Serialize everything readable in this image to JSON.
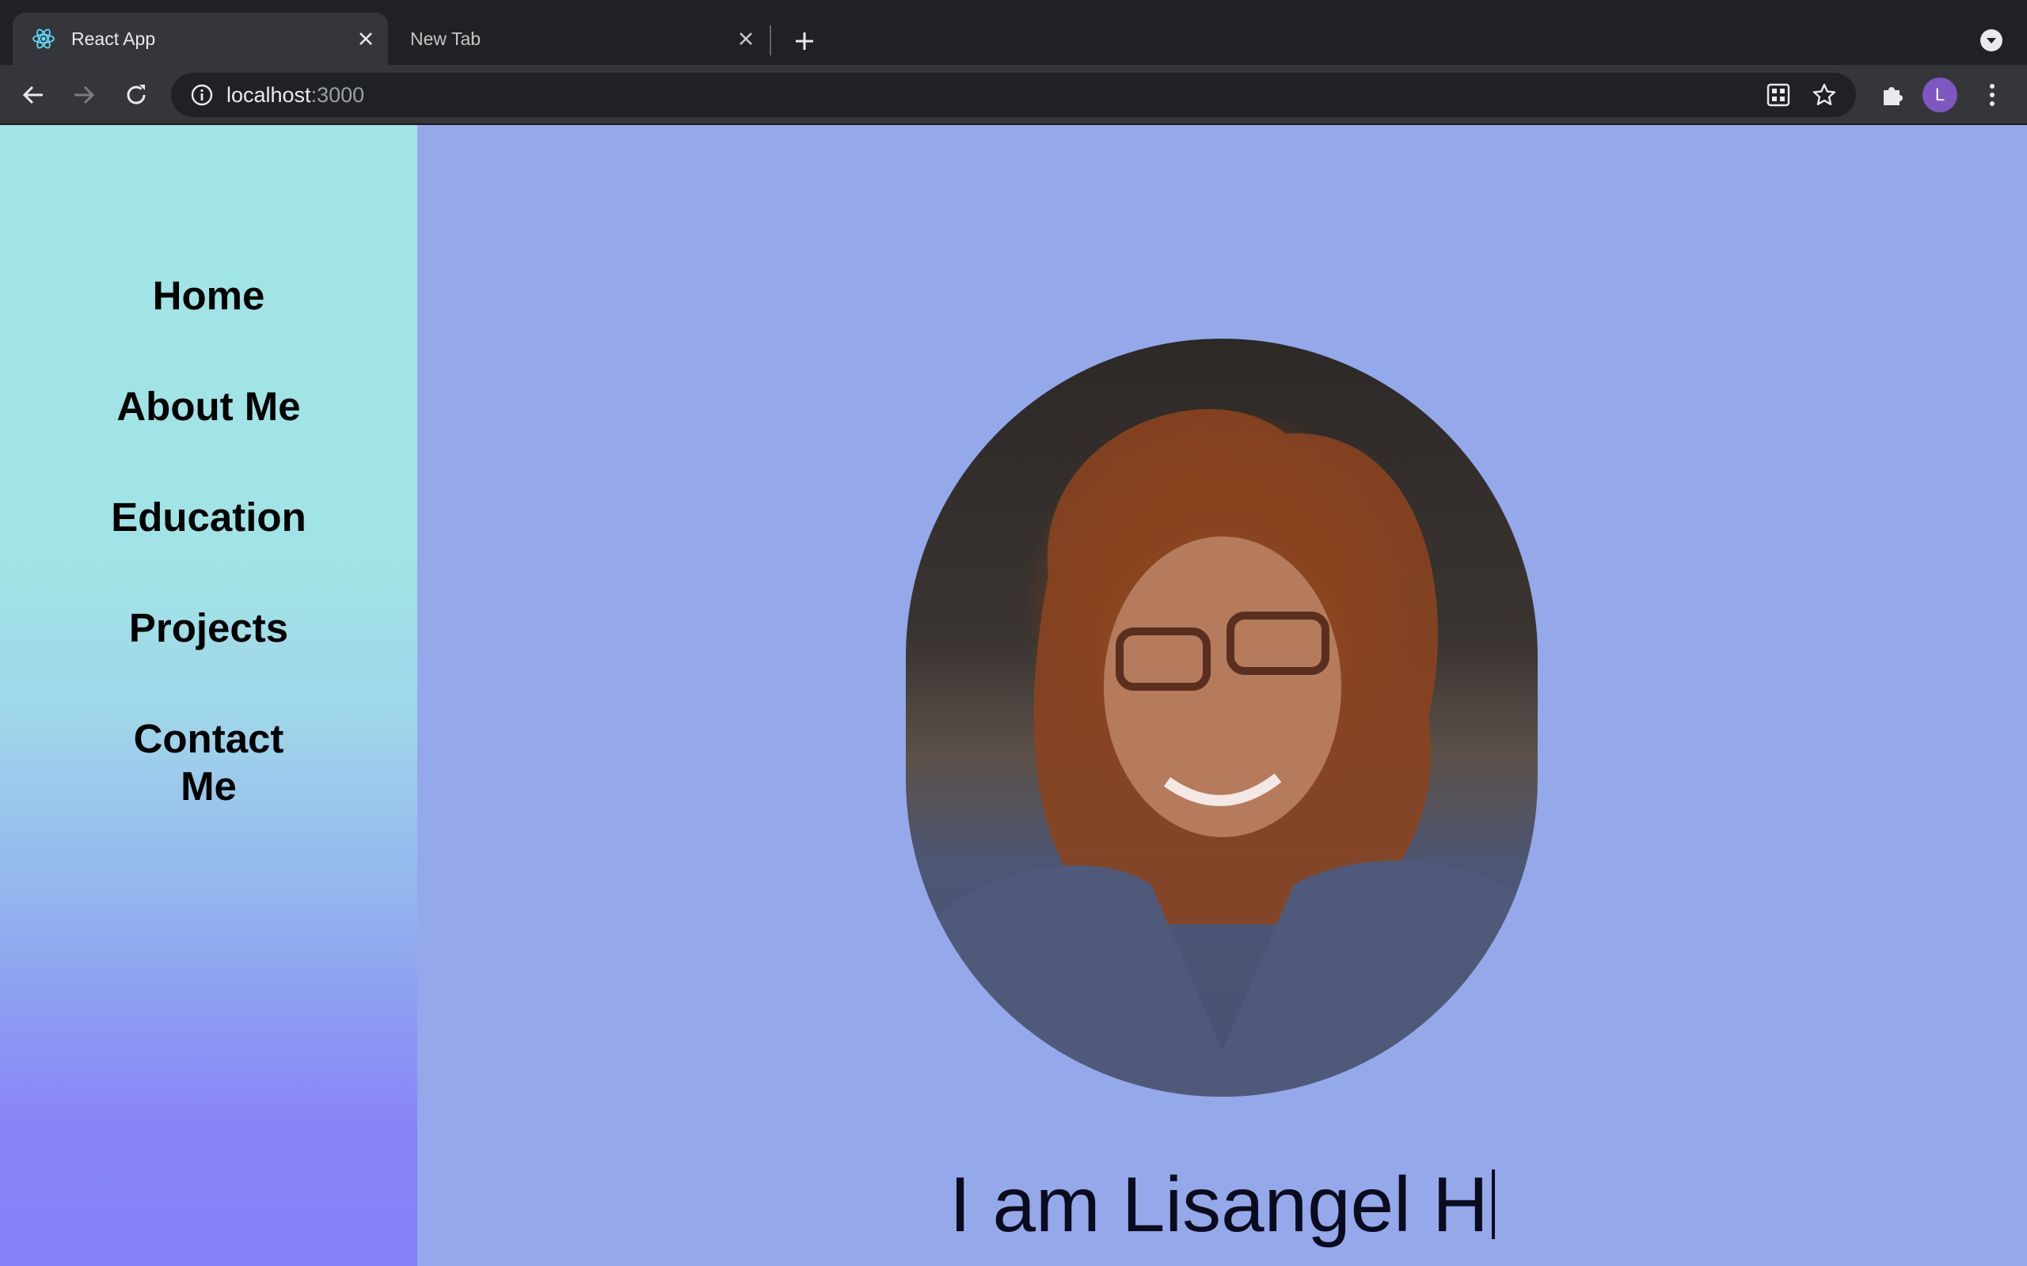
{
  "browser": {
    "tabs": [
      {
        "title": "React App",
        "active": true,
        "favicon": "react-icon"
      },
      {
        "title": "New Tab",
        "active": false
      }
    ],
    "url_host": "localhost",
    "url_port": ":3000",
    "profile_initial": "L",
    "colors": {
      "chrome_dark": "#202124",
      "chrome_toolbar": "#35363a",
      "profile": "#7e57c2"
    }
  },
  "sidebar": {
    "items": [
      {
        "label": "Home"
      },
      {
        "label": "About Me"
      },
      {
        "label": "Education"
      },
      {
        "label": "Projects"
      },
      {
        "label": "Contact Me"
      }
    ],
    "colors": {
      "top": "#a0e4e6",
      "bottom": "#8480f9"
    }
  },
  "main": {
    "background": "#95a8ea",
    "portrait": "portrait-photo",
    "headline": "I am Lisangel H"
  }
}
